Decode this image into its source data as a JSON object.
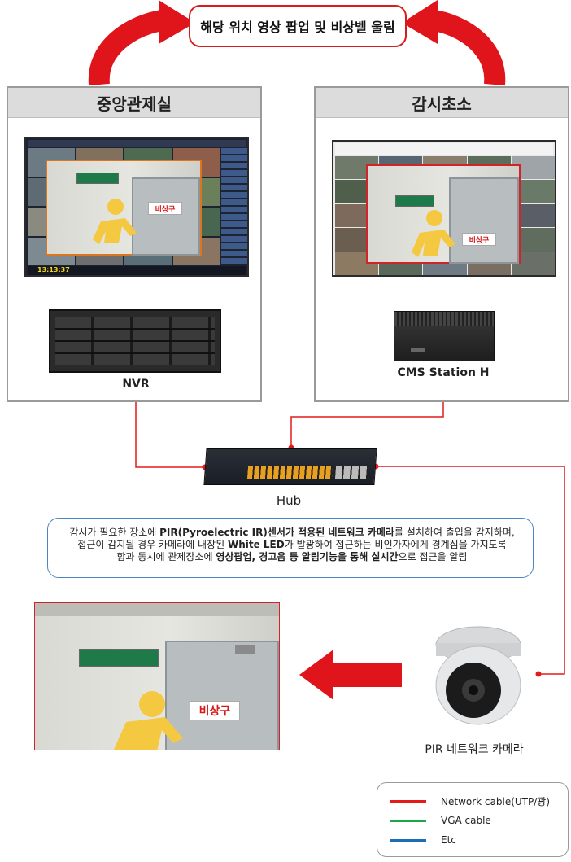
{
  "alert": {
    "text": "해당 위치 영상 팝업 및 비상벨 울림"
  },
  "panels": {
    "central": {
      "title": "중앙관제실",
      "device_label": "NVR"
    },
    "guard": {
      "title": "감시초소",
      "device_label": "CMS Station H"
    }
  },
  "hub": {
    "label": "Hub"
  },
  "scene": {
    "emergency_sign": "비상구"
  },
  "monitor_nvr": {
    "clock": "13:13:37"
  },
  "info": {
    "line1_a": "감시가 필요한 장소에 ",
    "line1_b": "PIR(Pyroelectric IR)센서가 적용된 네트워크 카메라",
    "line1_c": "를 설치하여 출입을 감지하며,",
    "line2_a": "접근이 감지될 경우 카메라에 내장된 ",
    "line2_b": "White LED",
    "line2_c": "가 발광하여 접근하는 비인가자에게 경계심을 가지도록",
    "line3_a": "함과 동시에 관제장소에 ",
    "line3_b": "영상팝업, 경고음 등 알림기능을 통해 실시간",
    "line3_c": "으로 접근을 알림"
  },
  "camera": {
    "label": "PIR 네트워크 카메라"
  },
  "legend": [
    {
      "label": "Network cable(UTP/광)",
      "color": "#e31b1b"
    },
    {
      "label": "VGA cable",
      "color": "#1aa84a"
    },
    {
      "label": "Etc",
      "color": "#1c6fb5"
    }
  ]
}
